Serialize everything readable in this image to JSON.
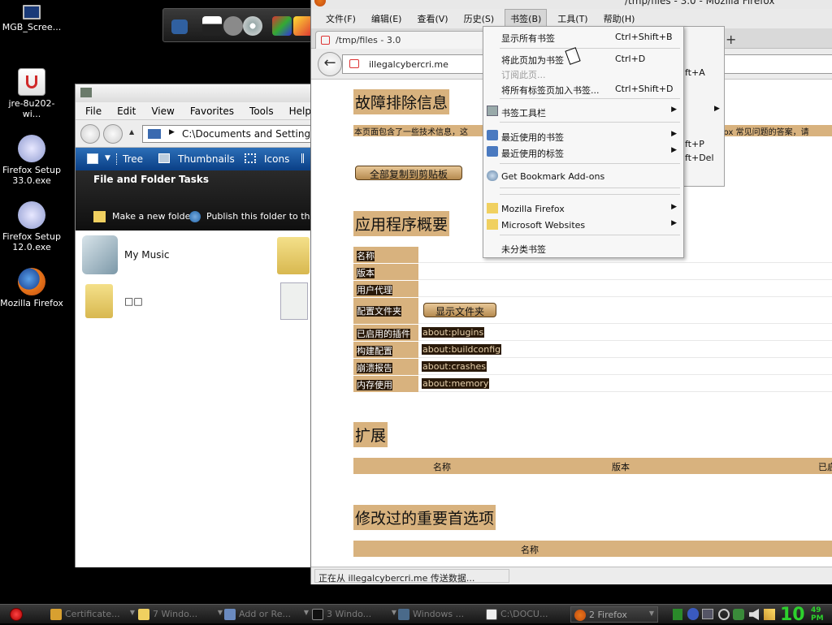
{
  "desktop": {
    "icons": [
      {
        "label": "MGB_Scree..."
      },
      {
        "label": "jre-8u202-wi..."
      },
      {
        "label": "Firefox Setup 33.0.exe"
      },
      {
        "label": "Firefox Setup 12.0.exe"
      },
      {
        "label": "Mozilla Firefox"
      }
    ]
  },
  "explorer": {
    "menu": [
      "File",
      "Edit",
      "View",
      "Favorites",
      "Tools",
      "Help"
    ],
    "address": "C:\\Documents and Settings\\hu",
    "toolbar": {
      "tree": "Tree",
      "thumbnails": "Thumbnails",
      "icons": "Icons"
    },
    "tasks_title": "File and Folder Tasks",
    "task_new_folder": "Make a new folder",
    "task_publish": "Publish this folder to the W",
    "items": [
      {
        "label": "My Music"
      },
      {
        "label": "□□"
      }
    ]
  },
  "firefox": {
    "window_title": "/tmp/files - 3.0 - Mozilla Firefox",
    "menubar": [
      "文件(F)",
      "编辑(E)",
      "查看(V)",
      "历史(S)",
      "书签(B)",
      "工具(T)",
      "帮助(H)"
    ],
    "tab_title": "/tmp/files - 3.0",
    "tab_new": "+",
    "url": "illegalcybercri.me",
    "status": "正在从 illegalcybercri.me 传送数据...",
    "page": {
      "h_troubleshoot": "故障排除信息",
      "desc_left": "本页面包含了一些技术信息，这",
      "desc_right": "efox 常见问题的答案，请",
      "copy_button": "全部复制到剪贴板",
      "h_app": "应用程序概要",
      "rows": [
        {
          "label": "名称",
          "value": ""
        },
        {
          "label": "版本",
          "value": ""
        },
        {
          "label": "用户代理",
          "value": ""
        },
        {
          "label": "配置文件夹",
          "value": ""
        },
        {
          "label": "已启用的插件",
          "value": "about:plugins"
        },
        {
          "label": "构建配置",
          "value": "about:buildconfig"
        },
        {
          "label": "崩溃报告",
          "value": "about:crashes"
        },
        {
          "label": "内存使用",
          "value": "about:memory"
        }
      ],
      "show_folder_button": "显示文件夹",
      "h_ext": "扩展",
      "ext_cols": [
        "名称",
        "版本",
        "已启"
      ],
      "h_prefs": "修改过的重要首选项",
      "prefs_col": "名称"
    }
  },
  "bookmarks_menu": {
    "items": [
      {
        "label": "显示所有书签",
        "shortcut": "Ctrl+Shift+B"
      },
      {
        "label": "将此页加为书签",
        "shortcut": "Ctrl+D"
      },
      {
        "label": "订阅此页...",
        "shortcut": ""
      },
      {
        "label": "将所有标签页加入书签...",
        "shortcut": "Ctrl+Shift+D"
      },
      {
        "label": "书签工具栏",
        "shortcut": ""
      },
      {
        "label": "最近使用的书签",
        "shortcut": ""
      },
      {
        "label": "最近使用的标签",
        "shortcut": ""
      },
      {
        "label": "Get Bookmark Add-ons",
        "shortcut": ""
      },
      {
        "label": "Mozilla Firefox",
        "shortcut": ""
      },
      {
        "label": "Microsoft Websites",
        "shortcut": ""
      },
      {
        "label": "未分类书签",
        "shortcut": ""
      }
    ]
  },
  "behind_submenu": {
    "sc1": "ft+A",
    "sc2": "ft+P",
    "sc3": "ft+Del"
  },
  "taskbar": {
    "buttons": [
      {
        "label": "Certificate..."
      },
      {
        "label": "7 Windo..."
      },
      {
        "label": "Add or Re..."
      },
      {
        "label": "3 Windo..."
      },
      {
        "label": "Windows ..."
      },
      {
        "label": "C:\\DOCU..."
      },
      {
        "label": "2 Firefox"
      }
    ],
    "clock_hour": "10",
    "clock_min": "49",
    "clock_ampm": "PM"
  }
}
